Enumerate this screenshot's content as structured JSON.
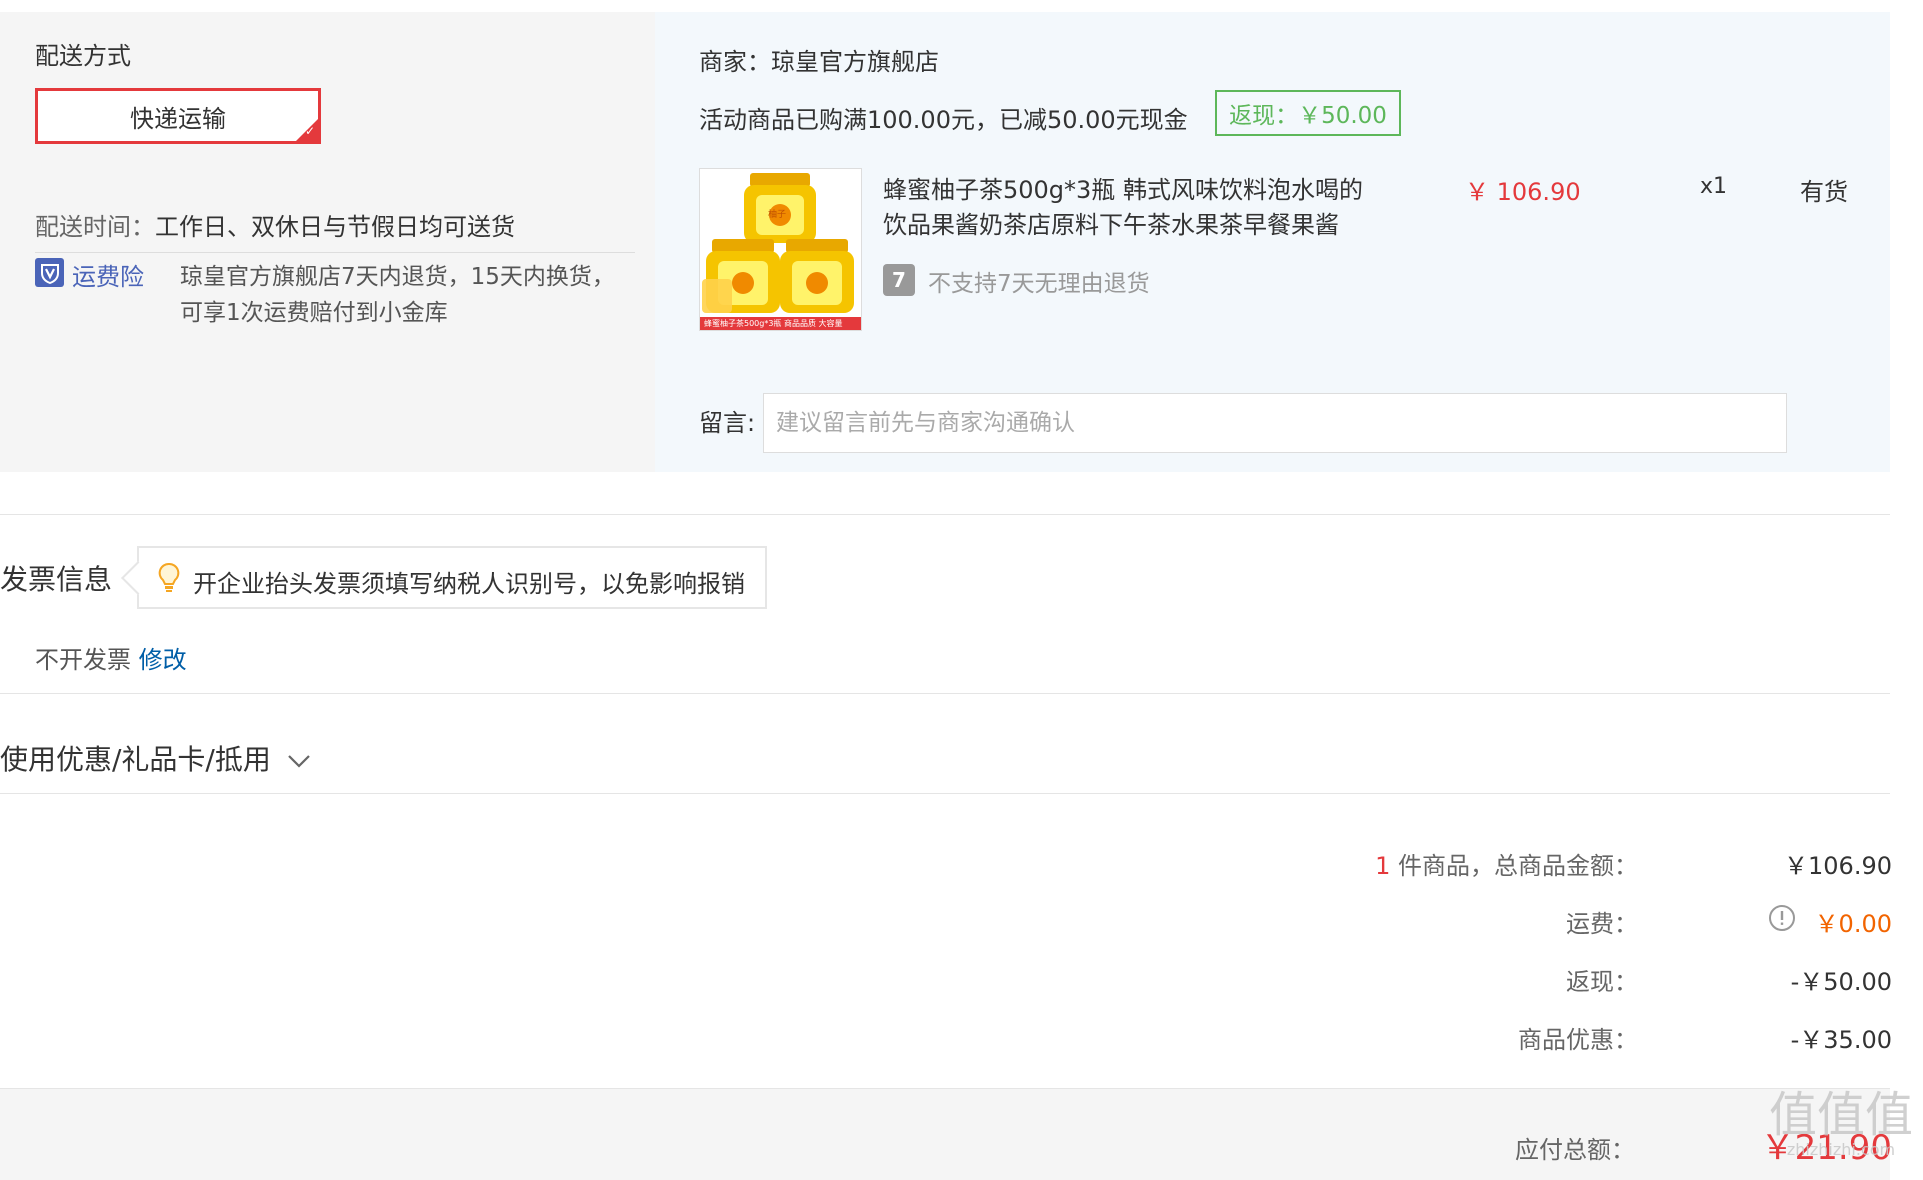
{
  "delivery": {
    "section_title": "配送方式",
    "method_label": "快递运输",
    "time_label": "配送时间：",
    "time_value": "工作日、双休日与节假日均可送货",
    "insurance_label": "运费险",
    "insurance_line1": "琼皇官方旗舰店7天内退货，15天内换货，",
    "insurance_line2": "可享1次运费赔付到小金库"
  },
  "merchant": {
    "label": "商家：",
    "name": "琼皇官方旗舰店",
    "promo_text": "活动商品已购满100.00元，已减50.00元现金",
    "cashback_label": "返现：",
    "cashback_value": "￥50.00"
  },
  "product": {
    "title_line1": "蜂蜜柚子茶500g*3瓶 韩式风味饮料泡水喝的",
    "title_line2": "饮品果酱奶茶店原料下午茶水果茶早餐果酱",
    "price": "￥ 106.90",
    "quantity": "x1",
    "stock": "有货",
    "return_policy": "不支持7天无理由退货",
    "return_icon_text": "7",
    "image_caption": "蜂蜜柚子茶500g*3瓶 商品品质 大容量",
    "jar_label": "柚子"
  },
  "message": {
    "label": "留言:",
    "placeholder": "建议留言前先与商家沟通确认"
  },
  "invoice": {
    "title": "发票信息",
    "tip": "开企业抬头发票须填写纳税人识别号，以免影响报销",
    "status": "不开发票",
    "edit_link": "修改"
  },
  "coupon": {
    "title": "使用优惠/礼品卡/抵用"
  },
  "summary": {
    "item_count": "1",
    "item_count_label": " 件商品，总商品金额：",
    "item_total": "￥106.90",
    "shipping_label": "运费：",
    "shipping_value": "￥0.00",
    "cashback_label": "返现：",
    "cashback_value": "-￥50.00",
    "discount_label": "商品优惠：",
    "discount_value": "-￥35.00",
    "payable_label": "应付总额：",
    "payable_value": "￥21.90"
  },
  "watermark": {
    "main": "值值值",
    "sub": "zhizhizhi.com"
  },
  "colors": {
    "accent_red": "#e4393c",
    "link_blue": "#005ea7",
    "green": "#5db75a",
    "orange": "#f26400",
    "insurance_blue": "#4a64b8"
  }
}
